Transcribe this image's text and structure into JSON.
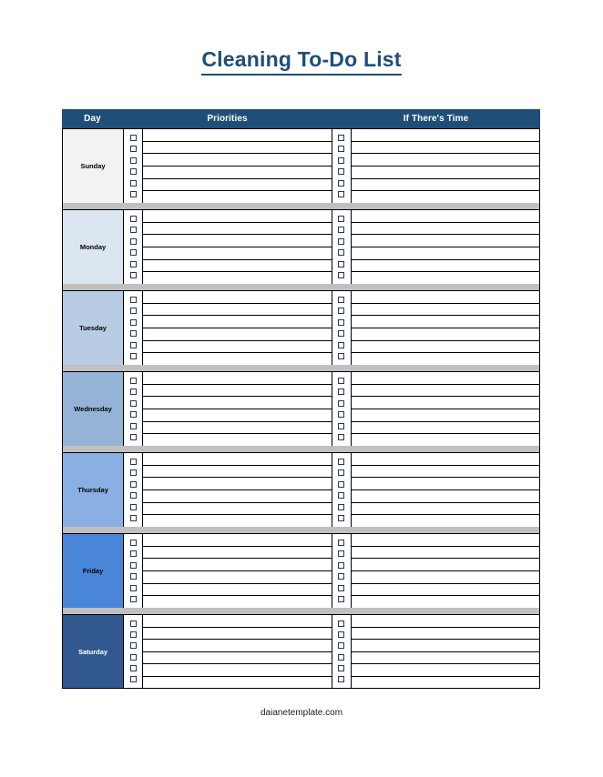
{
  "page": {
    "title": "Cleaning To-Do List",
    "footer": "daianetemplate.com",
    "title_color": "#1f4e79",
    "header_bg": "#1f4e79",
    "separator_color": "#c0c0c0",
    "checkbox_border": "#1f3864"
  },
  "table": {
    "headers": {
      "day": "Day",
      "priorities": "Priorities",
      "if_theres_time": "If There's Time"
    },
    "rows_per_day": 6,
    "days": [
      {
        "label": "Sunday",
        "bg": "#f2f2f2",
        "text": "#000000"
      },
      {
        "label": "Monday",
        "bg": "#dce6f1",
        "text": "#000000"
      },
      {
        "label": "Tuesday",
        "bg": "#b8cce4",
        "text": "#000000"
      },
      {
        "label": "Wednesday",
        "bg": "#95b3d7",
        "text": "#000000"
      },
      {
        "label": "Thursday",
        "bg": "#8ab0e3",
        "text": "#000000"
      },
      {
        "label": "Friday",
        "bg": "#4a86d8",
        "text": "#000000"
      },
      {
        "label": "Saturday",
        "bg": "#31588f",
        "text": "#ffffff"
      }
    ]
  }
}
